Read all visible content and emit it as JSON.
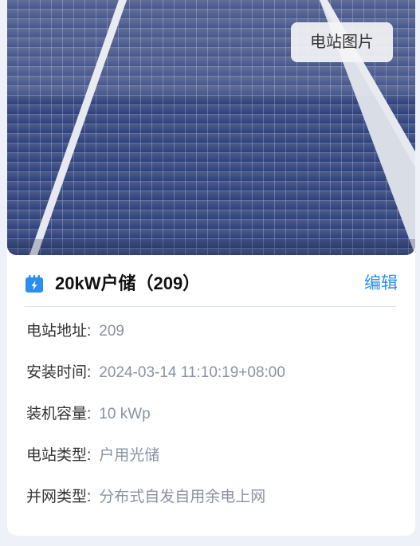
{
  "photo": {
    "tag_label": "电站图片"
  },
  "station": {
    "icon": "station-icon",
    "name": "20kW户储（209）",
    "edit_label": "编辑",
    "accent_color": "#2a8ef0"
  },
  "details": [
    {
      "label": "电站地址:",
      "value": "209"
    },
    {
      "label": "安装时间:",
      "value": "2024-03-14 11:10:19+08:00"
    },
    {
      "label": "装机容量:",
      "value": "10 kWp"
    },
    {
      "label": "电站类型:",
      "value": "户用光储"
    },
    {
      "label": "并网类型:",
      "value": "分布式自发自用余电上网"
    }
  ]
}
